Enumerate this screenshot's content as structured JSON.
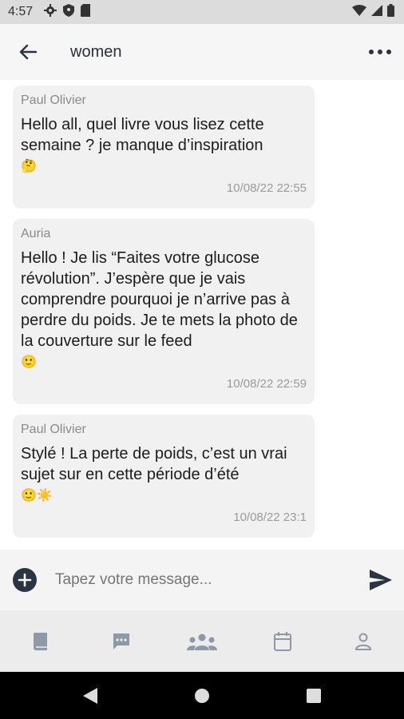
{
  "status_bar": {
    "time": "4:57"
  },
  "header": {
    "title": "women"
  },
  "messages": [
    {
      "author": "Paul Olivier",
      "text": "Hello all, quel livre vous lisez cette semaine ? je manque d’inspiration",
      "emoji": "🤔",
      "time": "10/08/22 22:55"
    },
    {
      "author": "Auria",
      "text": "Hello ! Je lis “Faites votre glucose révolution”. J’espère que je vais comprendre pourquoi je n’arrive pas à perdre du poids. Je te mets la photo de la couverture sur le feed",
      "emoji": "🙂",
      "time": "10/08/22 22:59"
    },
    {
      "author": "Paul Olivier",
      "text": "Stylé ! La perte de poids, c’est un vrai sujet sur en cette période d’été",
      "emoji": "🙂☀️",
      "time": "10/08/22 23:1"
    }
  ],
  "composer": {
    "placeholder": "Tapez votre message..."
  },
  "colors": {
    "icon_dark": "#2a3442",
    "nav_icon": "#8e99a8",
    "bubble": "#f1f1f1"
  }
}
